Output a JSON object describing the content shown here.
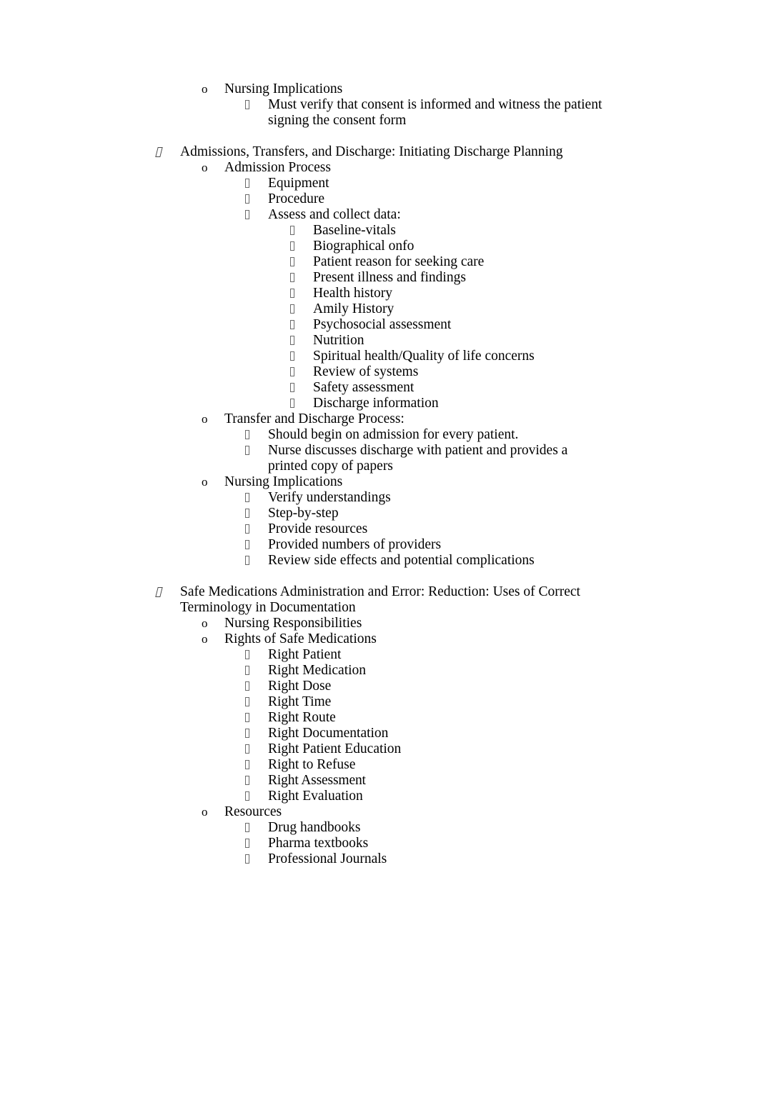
{
  "document": {
    "type": "outline-notes",
    "page_background": "#ffffff",
    "text_color": "#000000",
    "marker_glyphs": {
      "level1": "missing-glyph-slanted-box",
      "level2": "o",
      "level3": "missing-glyph-box",
      "level4": "missing-glyph-box"
    }
  },
  "outline": [
    {
      "level": 2,
      "marker": "o",
      "text": "Nursing Implications"
    },
    {
      "level": 3,
      "marker": "box",
      "text": "Must verify that consent is informed and witness the patient signing the consent form"
    },
    {
      "level": 1,
      "marker": "slanted-box",
      "spacer_before": true,
      "text": "Admissions, Transfers, and Discharge: Initiating Discharge Planning"
    },
    {
      "level": 2,
      "marker": "o",
      "text": "Admission Process"
    },
    {
      "level": 3,
      "marker": "box",
      "text": "Equipment"
    },
    {
      "level": 3,
      "marker": "box",
      "text": "Procedure"
    },
    {
      "level": 3,
      "marker": "box",
      "text": "Assess and collect data:"
    },
    {
      "level": 4,
      "marker": "box",
      "text": "Baseline-vitals"
    },
    {
      "level": 4,
      "marker": "box",
      "text": "Biographical onfo"
    },
    {
      "level": 4,
      "marker": "box",
      "text": "Patient reason for seeking care"
    },
    {
      "level": 4,
      "marker": "box",
      "text": "Present illness and findings"
    },
    {
      "level": 4,
      "marker": "box",
      "text": "Health history"
    },
    {
      "level": 4,
      "marker": "box",
      "text": "Amily History"
    },
    {
      "level": 4,
      "marker": "box",
      "text": "Psychosocial assessment"
    },
    {
      "level": 4,
      "marker": "box",
      "text": "Nutrition"
    },
    {
      "level": 4,
      "marker": "box",
      "text": "Spiritual health/Quality of life concerns"
    },
    {
      "level": 4,
      "marker": "box",
      "text": "Review of systems"
    },
    {
      "level": 4,
      "marker": "box",
      "text": "Safety assessment"
    },
    {
      "level": 4,
      "marker": "box",
      "text": "Discharge information"
    },
    {
      "level": 2,
      "marker": "o",
      "text": "Transfer and Discharge Process:"
    },
    {
      "level": 3,
      "marker": "box",
      "text": "Should begin on admission for every patient."
    },
    {
      "level": 3,
      "marker": "box",
      "text": "Nurse discusses discharge with patient and provides a printed copy of papers"
    },
    {
      "level": 2,
      "marker": "o",
      "text": "Nursing Implications"
    },
    {
      "level": 3,
      "marker": "box",
      "text": "Verify understandings"
    },
    {
      "level": 3,
      "marker": "box",
      "text": "Step-by-step"
    },
    {
      "level": 3,
      "marker": "box",
      "text": "Provide resources"
    },
    {
      "level": 3,
      "marker": "box",
      "text": "Provided numbers of providers"
    },
    {
      "level": 3,
      "marker": "box",
      "text": "Review side effects and potential complications"
    },
    {
      "level": 1,
      "marker": "slanted-box",
      "spacer_before": true,
      "text": "Safe Medications Administration and Error: Reduction: Uses of Correct Terminology in Documentation"
    },
    {
      "level": 2,
      "marker": "o",
      "text": "Nursing Responsibilities"
    },
    {
      "level": 2,
      "marker": "o",
      "text": "Rights of Safe Medications"
    },
    {
      "level": 3,
      "marker": "box",
      "text": "Right Patient"
    },
    {
      "level": 3,
      "marker": "box",
      "text": "Right Medication"
    },
    {
      "level": 3,
      "marker": "box",
      "text": "Right Dose"
    },
    {
      "level": 3,
      "marker": "box",
      "text": "Right Time"
    },
    {
      "level": 3,
      "marker": "box",
      "text": "Right Route"
    },
    {
      "level": 3,
      "marker": "box",
      "text": "Right Documentation"
    },
    {
      "level": 3,
      "marker": "box",
      "text": "Right Patient Education"
    },
    {
      "level": 3,
      "marker": "box",
      "text": "Right to Refuse"
    },
    {
      "level": 3,
      "marker": "box",
      "tight": true,
      "text": "Right Assessment"
    },
    {
      "level": 3,
      "marker": "box",
      "text": "Right Evaluation"
    },
    {
      "level": 2,
      "marker": "o",
      "text": "Resources"
    },
    {
      "level": 3,
      "marker": "box",
      "text": "Drug handbooks"
    },
    {
      "level": 3,
      "marker": "box",
      "text": "Pharma textbooks"
    },
    {
      "level": 3,
      "marker": "box",
      "text": "Professional Journals"
    }
  ]
}
